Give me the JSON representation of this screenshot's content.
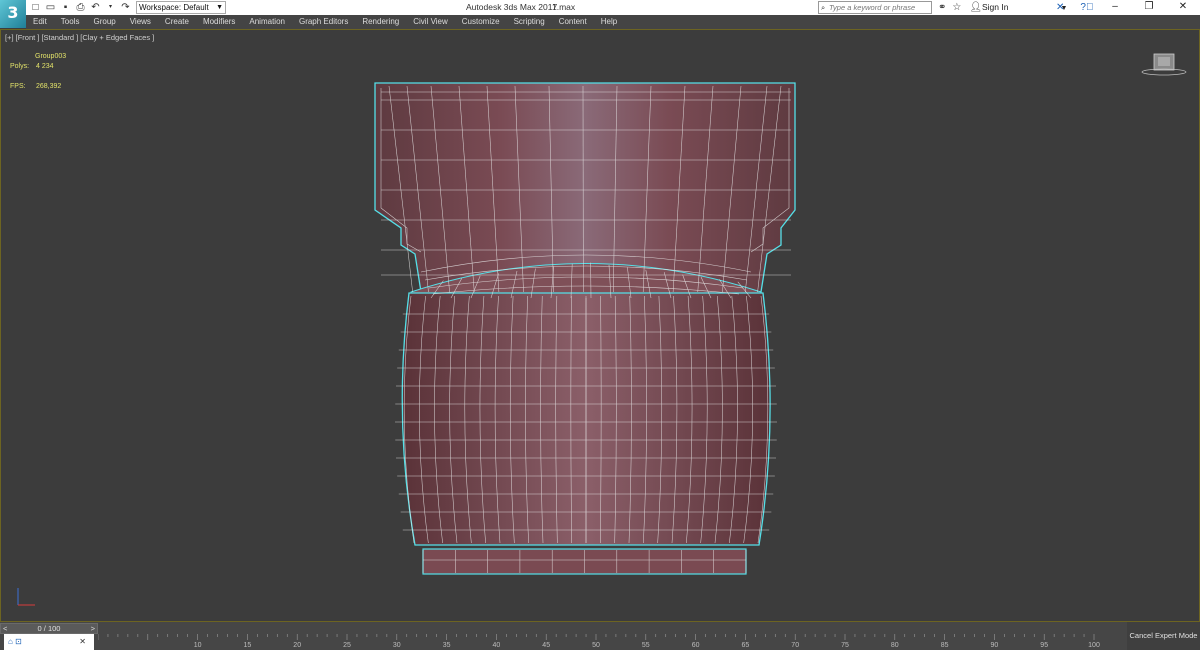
{
  "app": {
    "logo": "3",
    "title": "Autodesk 3ds Max 2017",
    "file": "1.max",
    "workspace_label": "Workspace: Default"
  },
  "titlebar": {
    "search_placeholder": "Type a keyword or phrase",
    "signin": "Sign In"
  },
  "menu": [
    "Edit",
    "Tools",
    "Group",
    "Views",
    "Create",
    "Modifiers",
    "Animation",
    "Graph Editors",
    "Rendering",
    "Civil View",
    "Customize",
    "Scripting",
    "Content",
    "Help"
  ],
  "viewport": {
    "label": "[+] [Front ] [Standard ] [Clay + Edged Faces ]",
    "stats": {
      "object": "Group003",
      "polys_label": "Polys:",
      "polys_value": "4 234",
      "fps_label": "FPS:",
      "fps_value": "268,392"
    }
  },
  "timeline": {
    "slider_text": "0 / 100",
    "prev": "<",
    "next": ">",
    "ticks": [
      10,
      15,
      20,
      25,
      30,
      35,
      40,
      45,
      50,
      55,
      60,
      65,
      70,
      75,
      80,
      85,
      90,
      95,
      100
    ]
  },
  "expert_mode": "Cancel Expert Mode",
  "colors": {
    "mesh_fill": "#7b4a52",
    "wire": "#e6e6e6",
    "selection": "#54e0e8",
    "stats_text": "#e3e36a",
    "viewport_bg": "#3c3c3c"
  }
}
